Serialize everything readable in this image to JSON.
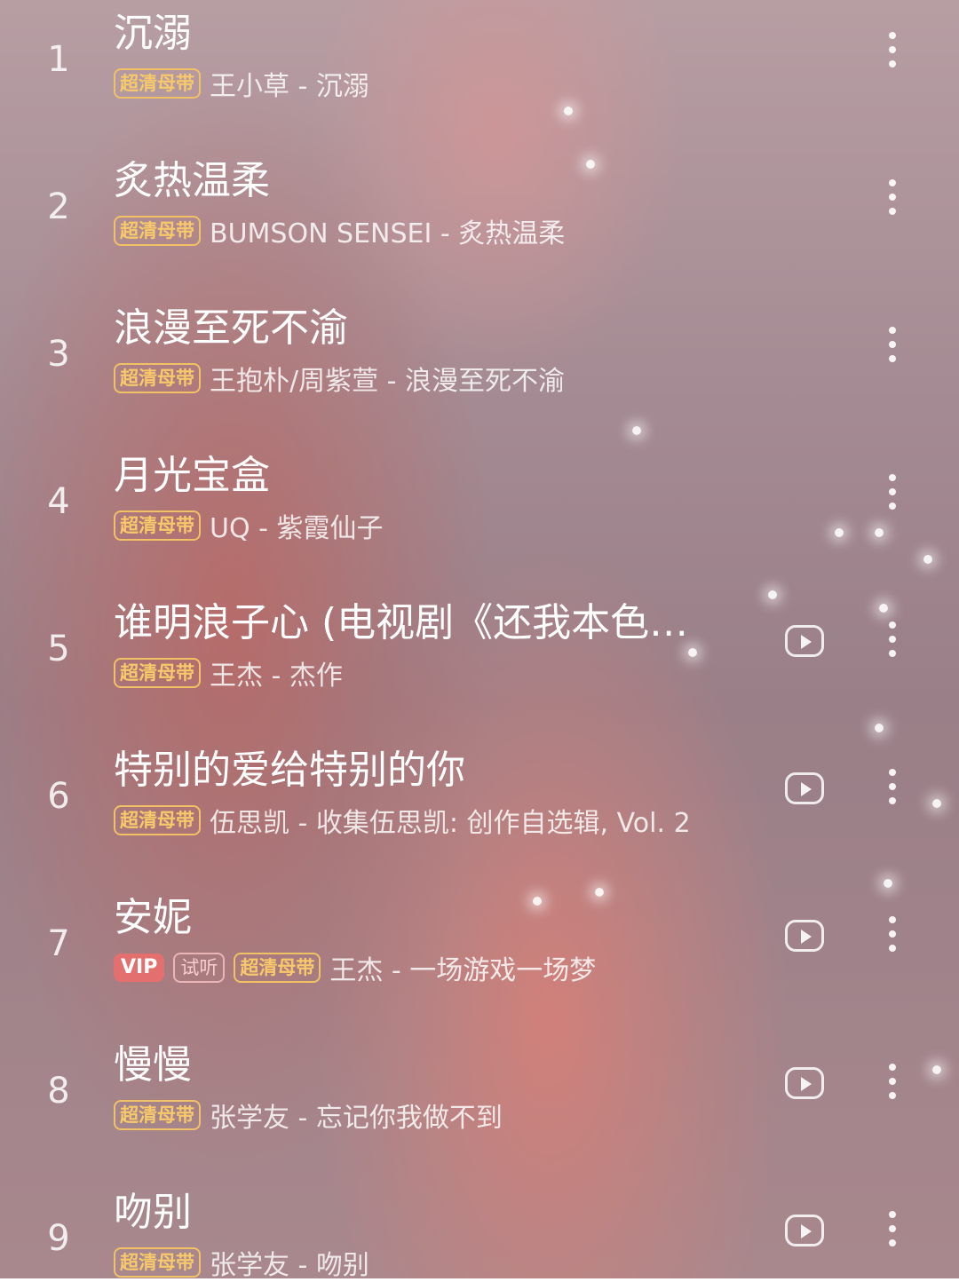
{
  "songs": [
    {
      "rank": "1",
      "title": "沉溺",
      "badges": [
        "超清母带"
      ],
      "artist_album": "王小草 - 沉溺",
      "has_mv": false
    },
    {
      "rank": "2",
      "title": "炙热温柔",
      "badges": [
        "超清母带"
      ],
      "artist_album": "BUMSON SENSEI - 炙热温柔",
      "has_mv": false
    },
    {
      "rank": "3",
      "title": "浪漫至死不渝",
      "badges": [
        "超清母带"
      ],
      "artist_album": "王抱朴/周紫萱 - 浪漫至死不渝",
      "has_mv": false
    },
    {
      "rank": "4",
      "title": "月光宝盒",
      "badges": [
        "超清母带"
      ],
      "artist_album": "UQ - 紫霞仙子",
      "has_mv": false
    },
    {
      "rank": "5",
      "title": "谁明浪子心 (电视剧《还我本色…",
      "badges": [
        "超清母带"
      ],
      "artist_album": "王杰 - 杰作",
      "has_mv": true
    },
    {
      "rank": "6",
      "title": "特别的爱给特别的你",
      "badges": [
        "超清母带"
      ],
      "artist_album": "伍思凯 - 收集伍思凯: 创作自选辑, Vol. 2",
      "has_mv": true
    },
    {
      "rank": "7",
      "title": "安妮",
      "vip": "VIP",
      "trial": "试听",
      "badges": [
        "超清母带"
      ],
      "artist_album": "王杰 - 一场游戏一场梦",
      "has_mv": true
    },
    {
      "rank": "8",
      "title": "慢慢",
      "badges": [
        "超清母带"
      ],
      "artist_album": "张学友 - 忘记你我做不到",
      "has_mv": true
    },
    {
      "rank": "9",
      "title": "吻别",
      "badges": [
        "超清母带"
      ],
      "artist_album": "张学友 - 吻别",
      "has_mv": true
    }
  ],
  "icons": {
    "mv": "play-video-icon",
    "more": "more-vertical-icon"
  },
  "colors": {
    "badge_gold": "#f2c165",
    "vip_red": "#e3706e",
    "background_pink": "#a58b93"
  }
}
